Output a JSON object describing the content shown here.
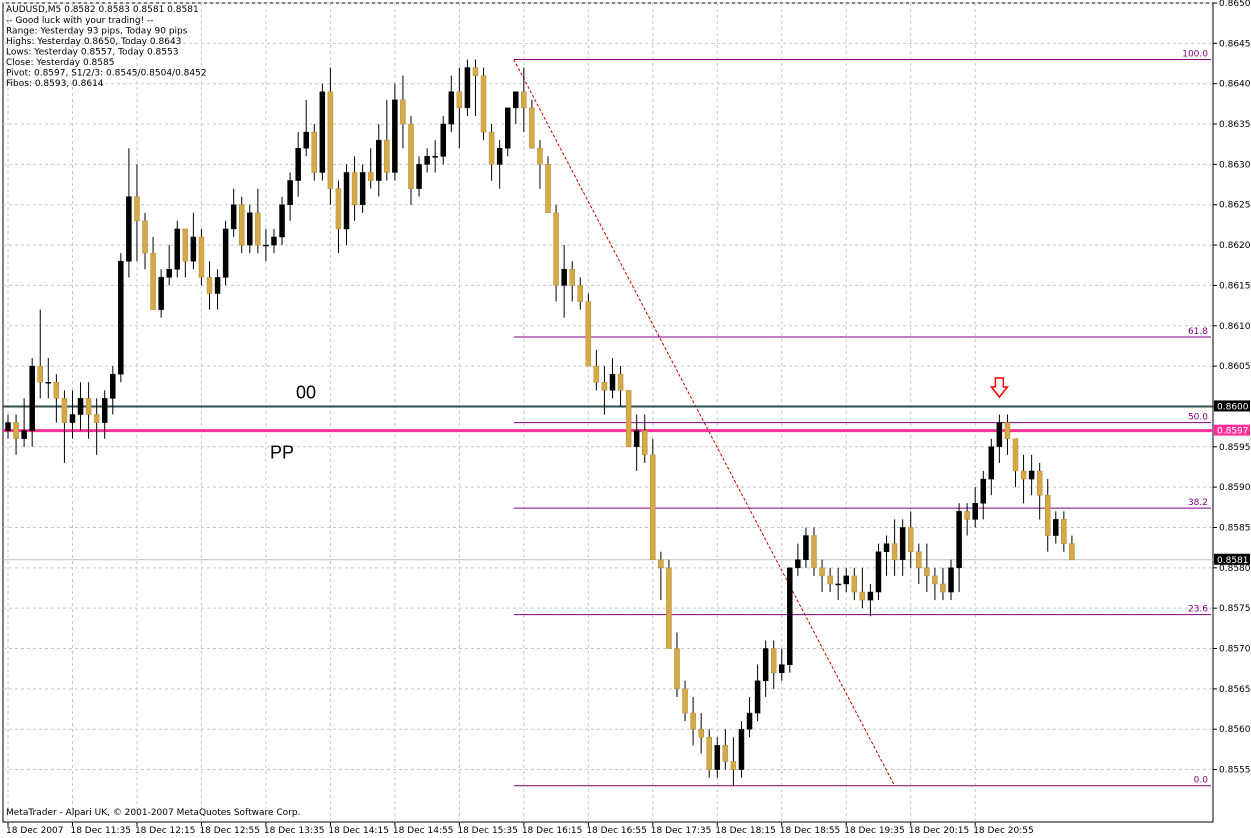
{
  "chart_data": {
    "type": "candlestick",
    "symbol_line": "AUDUSD,M5  0.8582 0.8583 0.8581 0.8581",
    "info_lines": [
      "-- Good luck with your trading! --",
      "Range: Yesterday 93 pips, Today 90 pips",
      "Highs: Yesterday 0.8650, Today 0.8643",
      "Lows:  Yesterday 0.8557, Today 0.8553",
      "Close: Yesterday 0.8585",
      "Pivot: 0.8597, S1/2/3: 0.8545/0.8504/0.8452",
      "Fibos: 0.8593, 0.8614"
    ],
    "footer": "MetaTrader - Alpari UK, © 2001-2007 MetaQuotes Software Corp.",
    "ylim": [
      0.85485,
      0.865
    ],
    "y_ticks": [
      "0.8650",
      "0.8645",
      "0.8640",
      "0.8635",
      "0.8630",
      "0.8625",
      "0.8620",
      "0.8615",
      "0.8610",
      "0.8605",
      "0.8600",
      "0.8595",
      "0.8590",
      "0.8585",
      "0.8580",
      "0.8575",
      "0.8570",
      "0.8565",
      "0.8560",
      "0.8555"
    ],
    "y_tick_values": [
      0.865,
      0.8645,
      0.864,
      0.8635,
      0.863,
      0.8625,
      0.862,
      0.8615,
      0.861,
      0.8605,
      0.86,
      0.8595,
      0.859,
      0.8585,
      0.858,
      0.8575,
      0.857,
      0.8565,
      0.856,
      0.8555
    ],
    "x_labels": [
      "18 Dec 2007",
      "18 Dec 11:35",
      "18 Dec 12:15",
      "18 Dec 12:55",
      "18 Dec 13:35",
      "18 Dec 14:15",
      "18 Dec 14:55",
      "18 Dec 15:35",
      "18 Dec 16:15",
      "18 Dec 16:55",
      "18 Dec 17:35",
      "18 Dec 18:15",
      "18 Dec 18:55",
      "18 Dec 19:35",
      "18 Dec 20:15",
      "18 Dec 20:55"
    ],
    "bars_per_x_label": 8,
    "candles": [
      [
        0.8597,
        0.8599,
        0.8596,
        0.8598
      ],
      [
        0.8598,
        0.8599,
        0.8594,
        0.8596
      ],
      [
        0.8596,
        0.8601,
        0.8595,
        0.8597
      ],
      [
        0.8597,
        0.8606,
        0.8595,
        0.8605
      ],
      [
        0.8605,
        0.8612,
        0.8601,
        0.8603
      ],
      [
        0.8603,
        0.8606,
        0.8601,
        0.8603
      ],
      [
        0.8603,
        0.8604,
        0.8598,
        0.8601
      ],
      [
        0.8601,
        0.8602,
        0.8593,
        0.8598
      ],
      [
        0.8598,
        0.8602,
        0.8596,
        0.8599
      ],
      [
        0.8599,
        0.8603,
        0.8597,
        0.8601
      ],
      [
        0.8601,
        0.8603,
        0.8596,
        0.8599
      ],
      [
        0.8599,
        0.8601,
        0.8594,
        0.8598
      ],
      [
        0.8598,
        0.8602,
        0.8596,
        0.8601
      ],
      [
        0.8601,
        0.8605,
        0.8599,
        0.8604
      ],
      [
        0.8604,
        0.8619,
        0.8603,
        0.8618
      ],
      [
        0.8618,
        0.8632,
        0.8616,
        0.8626
      ],
      [
        0.8626,
        0.863,
        0.8618,
        0.8623
      ],
      [
        0.8623,
        0.8624,
        0.8617,
        0.8619
      ],
      [
        0.8619,
        0.8621,
        0.8612,
        0.8612
      ],
      [
        0.8612,
        0.8617,
        0.8611,
        0.8616
      ],
      [
        0.8616,
        0.862,
        0.8615,
        0.8617
      ],
      [
        0.8617,
        0.8623,
        0.8616,
        0.8622
      ],
      [
        0.8622,
        0.8622,
        0.8616,
        0.8618
      ],
      [
        0.8618,
        0.8624,
        0.8617,
        0.8621
      ],
      [
        0.8621,
        0.8622,
        0.8615,
        0.8616
      ],
      [
        0.8616,
        0.8618,
        0.8612,
        0.8614
      ],
      [
        0.8614,
        0.8617,
        0.8612,
        0.8616
      ],
      [
        0.8616,
        0.8623,
        0.8615,
        0.8622
      ],
      [
        0.8622,
        0.8627,
        0.8621,
        0.8625
      ],
      [
        0.8625,
        0.8626,
        0.8619,
        0.862
      ],
      [
        0.862,
        0.8625,
        0.8619,
        0.8624
      ],
      [
        0.8624,
        0.8627,
        0.8619,
        0.862
      ],
      [
        0.862,
        0.8622,
        0.8618,
        0.862
      ],
      [
        0.862,
        0.8622,
        0.8619,
        0.8621
      ],
      [
        0.8621,
        0.8626,
        0.862,
        0.8625
      ],
      [
        0.8625,
        0.8629,
        0.8623,
        0.8628
      ],
      [
        0.8628,
        0.8634,
        0.8626,
        0.8632
      ],
      [
        0.8632,
        0.8638,
        0.8631,
        0.8634
      ],
      [
        0.8634,
        0.8635,
        0.8628,
        0.8629
      ],
      [
        0.8629,
        0.864,
        0.8628,
        0.8639
      ],
      [
        0.8639,
        0.8642,
        0.8625,
        0.8627
      ],
      [
        0.8627,
        0.8628,
        0.8619,
        0.8622
      ],
      [
        0.8622,
        0.863,
        0.862,
        0.8629
      ],
      [
        0.8629,
        0.8631,
        0.8623,
        0.8625
      ],
      [
        0.8625,
        0.863,
        0.8624,
        0.8629
      ],
      [
        0.8629,
        0.8632,
        0.8627,
        0.8628
      ],
      [
        0.8628,
        0.8635,
        0.8626,
        0.8633
      ],
      [
        0.8633,
        0.8638,
        0.8628,
        0.8629
      ],
      [
        0.8629,
        0.864,
        0.8628,
        0.8638
      ],
      [
        0.8638,
        0.8641,
        0.8632,
        0.8635
      ],
      [
        0.8635,
        0.8636,
        0.8625,
        0.8627
      ],
      [
        0.8627,
        0.8631,
        0.8626,
        0.863
      ],
      [
        0.863,
        0.8632,
        0.8629,
        0.8631
      ],
      [
        0.8631,
        0.8633,
        0.8629,
        0.8631
      ],
      [
        0.8631,
        0.8636,
        0.863,
        0.8635
      ],
      [
        0.8635,
        0.8641,
        0.8634,
        0.8639
      ],
      [
        0.8639,
        0.8642,
        0.8632,
        0.8637
      ],
      [
        0.8637,
        0.8643,
        0.8636,
        0.8642
      ],
      [
        0.8642,
        0.8643,
        0.8636,
        0.8641
      ],
      [
        0.8641,
        0.8642,
        0.8633,
        0.8634
      ],
      [
        0.8634,
        0.8635,
        0.8628,
        0.863
      ],
      [
        0.863,
        0.8633,
        0.8627,
        0.8632
      ],
      [
        0.8632,
        0.8637,
        0.8631,
        0.8637
      ],
      [
        0.8637,
        0.8639,
        0.8635,
        0.8639
      ],
      [
        0.8639,
        0.8642,
        0.8634,
        0.8637
      ],
      [
        0.8637,
        0.8638,
        0.8632,
        0.8632
      ],
      [
        0.8632,
        0.8633,
        0.8627,
        0.863
      ],
      [
        0.863,
        0.8631,
        0.8624,
        0.8624
      ],
      [
        0.8624,
        0.8625,
        0.8613,
        0.8615
      ],
      [
        0.8615,
        0.862,
        0.8611,
        0.8617
      ],
      [
        0.8617,
        0.8618,
        0.8613,
        0.8615
      ],
      [
        0.8615,
        0.8616,
        0.8612,
        0.8613
      ],
      [
        0.8613,
        0.8614,
        0.8605,
        0.8605
      ],
      [
        0.8605,
        0.8607,
        0.8602,
        0.8603
      ],
      [
        0.8603,
        0.8605,
        0.8599,
        0.8602
      ],
      [
        0.8602,
        0.8606,
        0.8601,
        0.8604
      ],
      [
        0.8604,
        0.8605,
        0.86,
        0.8602
      ],
      [
        0.8602,
        0.8602,
        0.8596,
        0.8595
      ],
      [
        0.8595,
        0.8599,
        0.8592,
        0.8597
      ],
      [
        0.8597,
        0.8599,
        0.8593,
        0.8594
      ],
      [
        0.8594,
        0.8596,
        0.8582,
        0.8581
      ],
      [
        0.8581,
        0.8582,
        0.8576,
        0.858
      ],
      [
        0.858,
        0.8581,
        0.857,
        0.857
      ],
      [
        0.857,
        0.8572,
        0.8564,
        0.8565
      ],
      [
        0.8565,
        0.8566,
        0.8561,
        0.8562
      ],
      [
        0.8562,
        0.8564,
        0.8558,
        0.856
      ],
      [
        0.856,
        0.8562,
        0.8557,
        0.8559
      ],
      [
        0.8559,
        0.856,
        0.8554,
        0.8555
      ],
      [
        0.8555,
        0.8559,
        0.8554,
        0.8558
      ],
      [
        0.8558,
        0.856,
        0.8555,
        0.8556
      ],
      [
        0.8556,
        0.8559,
        0.8553,
        0.8555
      ],
      [
        0.8555,
        0.8561,
        0.8554,
        0.856
      ],
      [
        0.856,
        0.8564,
        0.8559,
        0.8562
      ],
      [
        0.8562,
        0.8568,
        0.8561,
        0.8566
      ],
      [
        0.8566,
        0.8571,
        0.8564,
        0.857
      ],
      [
        0.857,
        0.8571,
        0.8565,
        0.8567
      ],
      [
        0.8567,
        0.857,
        0.8566,
        0.8568
      ],
      [
        0.8568,
        0.858,
        0.8567,
        0.858
      ],
      [
        0.858,
        0.8583,
        0.8579,
        0.8581
      ],
      [
        0.8581,
        0.8585,
        0.858,
        0.8584
      ],
      [
        0.8584,
        0.8585,
        0.8579,
        0.858
      ],
      [
        0.858,
        0.8581,
        0.8577,
        0.8579
      ],
      [
        0.8579,
        0.858,
        0.8577,
        0.8578
      ],
      [
        0.8578,
        0.858,
        0.8576,
        0.8578
      ],
      [
        0.8578,
        0.858,
        0.8577,
        0.8579
      ],
      [
        0.8579,
        0.858,
        0.8576,
        0.8577
      ],
      [
        0.8577,
        0.858,
        0.8575,
        0.8576
      ],
      [
        0.8576,
        0.8578,
        0.8574,
        0.8577
      ],
      [
        0.8577,
        0.8583,
        0.8576,
        0.8582
      ],
      [
        0.8582,
        0.8584,
        0.8579,
        0.8583
      ],
      [
        0.8583,
        0.8586,
        0.8579,
        0.8581
      ],
      [
        0.8581,
        0.8586,
        0.8579,
        0.8585
      ],
      [
        0.8585,
        0.8587,
        0.858,
        0.8582
      ],
      [
        0.8582,
        0.8583,
        0.8578,
        0.858
      ],
      [
        0.858,
        0.8583,
        0.8577,
        0.8579
      ],
      [
        0.8579,
        0.858,
        0.8576,
        0.8578
      ],
      [
        0.8578,
        0.858,
        0.8576,
        0.8577
      ],
      [
        0.8577,
        0.8581,
        0.8576,
        0.858
      ],
      [
        0.858,
        0.8588,
        0.8577,
        0.8587
      ],
      [
        0.8587,
        0.8588,
        0.8584,
        0.8586
      ],
      [
        0.8586,
        0.859,
        0.8585,
        0.8588
      ],
      [
        0.8588,
        0.8592,
        0.8586,
        0.8591
      ],
      [
        0.8591,
        0.8596,
        0.8589,
        0.8595
      ],
      [
        0.8595,
        0.8599,
        0.8593,
        0.8598
      ],
      [
        0.8598,
        0.8599,
        0.8594,
        0.8596
      ],
      [
        0.8596,
        0.8596,
        0.859,
        0.8592
      ],
      [
        0.8592,
        0.8594,
        0.8588,
        0.8591
      ],
      [
        0.8591,
        0.8594,
        0.8589,
        0.8592
      ],
      [
        0.8592,
        0.8593,
        0.8586,
        0.8589
      ],
      [
        0.8589,
        0.8591,
        0.8582,
        0.8584
      ],
      [
        0.8584,
        0.8587,
        0.8583,
        0.8586
      ],
      [
        0.8586,
        0.8587,
        0.8582,
        0.8583
      ],
      [
        0.8583,
        0.8584,
        0.8581,
        0.8581
      ]
    ],
    "horizontal_lines": [
      {
        "name": "round-number",
        "label": "00",
        "value": 0.86,
        "price_tag": "0.8600",
        "color": "#2f4f4f"
      },
      {
        "name": "pivot",
        "label": "PP",
        "value": 0.8597,
        "price_tag": "0.8597",
        "color": "#ff3399"
      },
      {
        "name": "current-price",
        "label": "",
        "value": 0.8581,
        "price_tag": "0.8581",
        "color": "#c0c0c0"
      }
    ],
    "fibonacci": {
      "high": 0.8643,
      "low": 0.8553,
      "levels": [
        {
          "label": "100.0",
          "value": 0.8643
        },
        {
          "label": "61.8",
          "value": 0.86086
        },
        {
          "label": "50.0",
          "value": 0.8598
        },
        {
          "label": "38.2",
          "value": 0.85874
        },
        {
          "label": "23.6",
          "value": 0.85742
        },
        {
          "label": "0.0",
          "value": 0.8553
        }
      ],
      "start_bar": 63,
      "end_bar": 110,
      "color": "#800080"
    },
    "colors": {
      "bull": "#000000",
      "bear": "#d4a94a",
      "grid": "#c8c8c8",
      "arrow": "#ff0000"
    },
    "arrow_icon": "down-arrow-icon",
    "arrow_bar": 123
  }
}
